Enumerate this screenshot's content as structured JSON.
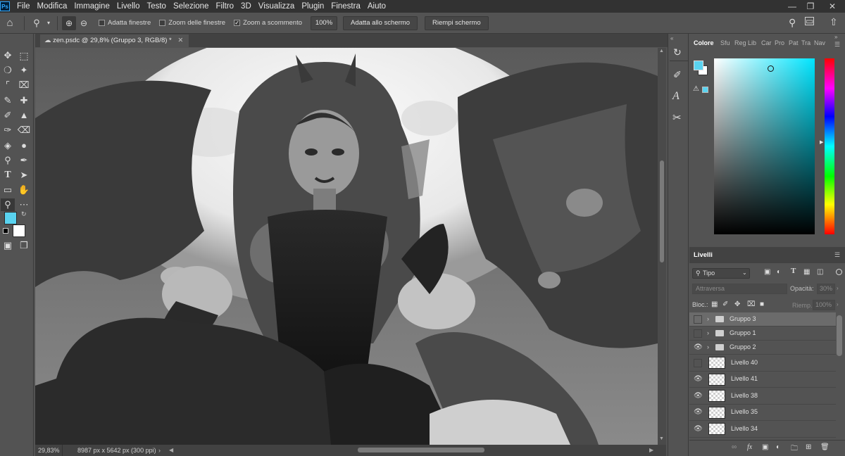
{
  "app": {
    "logo": "Ps"
  },
  "menu": [
    "File",
    "Modifica",
    "Immagine",
    "Livello",
    "Testo",
    "Selezione",
    "Filtro",
    "3D",
    "Visualizza",
    "Plugin",
    "Finestra",
    "Aiuto"
  ],
  "options": {
    "fit_windows": "Adatta finestre",
    "zoom_all_windows": "Zoom delle finestre",
    "scrubby_zoom": "Zoom a scommento",
    "zoom_value": "100%",
    "fit_screen": "Adatta allo schermo",
    "fill_screen": "Riempi schermo"
  },
  "document": {
    "tab_title": "zen.psdc @ 29,8% (Gruppo 3, RGB/8) *",
    "zoom": "29,83%",
    "info": "8987 px x 5642 px (300 ppi)"
  },
  "color_panel": {
    "tabs": [
      "Colore",
      "Sfu",
      "Reg",
      "Lib",
      "Car",
      "Pro",
      "Pat",
      "Tra",
      "Nav"
    ],
    "foreground": "#5ad3f0",
    "background": "#ffffff",
    "hue_color": "#00e5ff"
  },
  "layers_panel": {
    "title": "Livelli",
    "filter_label": "Tipo",
    "blend_mode": "Attraversa",
    "opacity_label": "Opacità:",
    "opacity_value": "30%",
    "lock_label": "Bloc.:",
    "fill_label": "Riemp.:",
    "fill_value": "100%",
    "layers": [
      {
        "name": "Gruppo 3",
        "type": "group",
        "visible": false,
        "selected": true
      },
      {
        "name": "Gruppo 1",
        "type": "group",
        "visible": false,
        "selected": false
      },
      {
        "name": "Gruppo 2",
        "type": "group",
        "visible": true,
        "selected": false
      },
      {
        "name": "Livello 40",
        "type": "layer",
        "visible": false,
        "selected": false
      },
      {
        "name": "Livello 41",
        "type": "layer",
        "visible": true,
        "selected": false
      },
      {
        "name": "Livello 38",
        "type": "layer",
        "visible": true,
        "selected": false
      },
      {
        "name": "Livello 35",
        "type": "layer",
        "visible": true,
        "selected": false
      },
      {
        "name": "Livello 34",
        "type": "layer",
        "visible": true,
        "selected": false
      }
    ]
  }
}
